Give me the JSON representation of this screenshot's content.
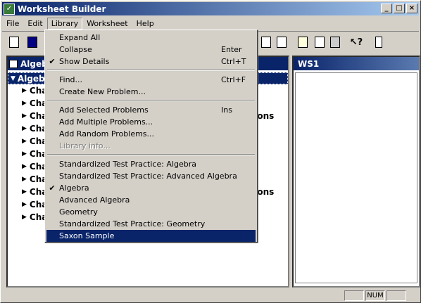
{
  "window": {
    "title": "Worksheet Builder"
  },
  "menubar": {
    "items": [
      "File",
      "Edit",
      "Library",
      "Worksheet",
      "Help"
    ]
  },
  "left_panel": {
    "header": "Algeb",
    "root": "Algeb",
    "items": [
      "Cha",
      "Cha",
      "Cha",
      "Cha",
      "Cha",
      "Cha",
      "Cha",
      "Cha",
      "Cha",
      "Cha",
      "Cha"
    ],
    "visible_suffixes": {
      "chapter3": "ons",
      "chapter9": "ons"
    }
  },
  "right_panel": {
    "header": "WS1"
  },
  "statusbar": {
    "num": "NUM"
  },
  "library_menu": {
    "expand_all": "Expand All",
    "collapse": "Collapse",
    "collapse_shortcut": "Enter",
    "show_details": "Show Details",
    "show_details_shortcut": "Ctrl+T",
    "find": "Find...",
    "find_shortcut": "Ctrl+F",
    "create_new": "Create New Problem...",
    "add_selected": "Add Selected Problems",
    "add_selected_shortcut": "Ins",
    "add_multiple": "Add Multiple Problems...",
    "add_random": "Add Random Problems...",
    "library_info": "Library info...",
    "stp_algebra": "Standardized Test Practice: Algebra",
    "stp_adv_algebra": "Standardized Test Practice: Advanced Algebra",
    "algebra": "Algebra",
    "adv_algebra": "Advanced Algebra",
    "geometry": "Geometry",
    "stp_geometry": "Standardized Test Practice: Geometry",
    "saxon_sample": "Saxon Sample"
  },
  "colors": {
    "highlight": "#0a246a",
    "face": "#d4d0c8"
  }
}
